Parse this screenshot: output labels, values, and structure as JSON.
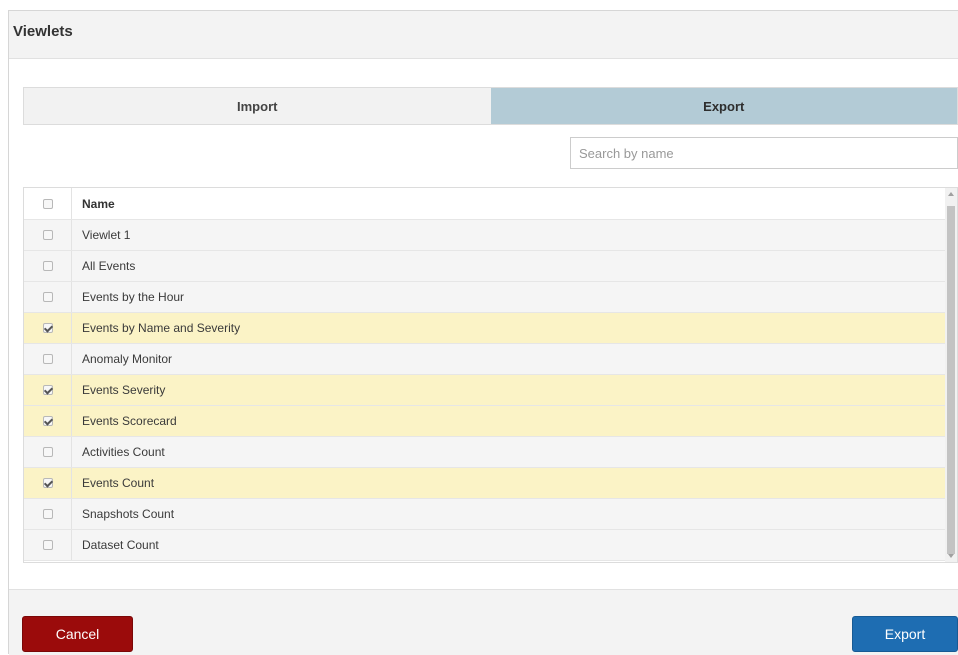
{
  "dialog": {
    "title": "Viewlets"
  },
  "tabs": [
    {
      "label": "Import",
      "active": false
    },
    {
      "label": "Export",
      "active": true
    }
  ],
  "search": {
    "placeholder": "Search by name",
    "value": ""
  },
  "table": {
    "header": {
      "name_label": "Name",
      "all_checked": false
    },
    "rows": [
      {
        "name": "Viewlet 1",
        "checked": false
      },
      {
        "name": "All Events",
        "checked": false
      },
      {
        "name": "Events by the Hour",
        "checked": false
      },
      {
        "name": "Events by Name and Severity",
        "checked": true
      },
      {
        "name": "Anomaly Monitor",
        "checked": false
      },
      {
        "name": "Events Severity",
        "checked": true
      },
      {
        "name": "Events Scorecard",
        "checked": true
      },
      {
        "name": "Activities Count",
        "checked": false
      },
      {
        "name": "Events Count",
        "checked": true
      },
      {
        "name": "Snapshots Count",
        "checked": false
      },
      {
        "name": "Dataset Count",
        "checked": false
      }
    ]
  },
  "footer": {
    "cancel_label": "Cancel",
    "export_label": "Export"
  },
  "colors": {
    "active_tab": "#b3cbd6",
    "checked_row": "#fbf3c6",
    "cancel_button": "#9b0b0b",
    "export_button": "#1e6db2"
  }
}
